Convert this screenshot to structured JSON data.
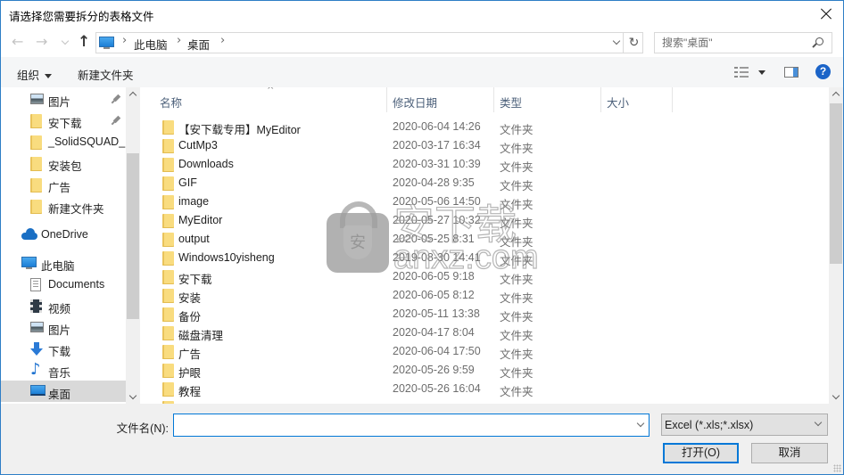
{
  "window": {
    "title": "请选择您需要拆分的表格文件"
  },
  "navigation": {
    "back_glyph": "←",
    "forward_glyph": "→",
    "up_glyph": "↑",
    "refresh_glyph": "↻"
  },
  "address": {
    "location_icon": "pc-icon",
    "separator": "›",
    "segments": [
      "此电脑",
      "桌面"
    ]
  },
  "search": {
    "placeholder": "搜索\"桌面\"",
    "value": ""
  },
  "toolbar": {
    "organize_label": "组织",
    "new_folder_label": "新建文件夹",
    "help_glyph": "?"
  },
  "sidebar": {
    "items": [
      {
        "label": "图片",
        "icon": "pictures-icon",
        "level": 2,
        "pinned": true,
        "selected": false
      },
      {
        "label": "安下载",
        "icon": "folder-icon",
        "level": 2,
        "pinned": true,
        "selected": false
      },
      {
        "label": "_SolidSQUAD_",
        "icon": "folder-icon",
        "level": 2,
        "pinned": false,
        "selected": false
      },
      {
        "label": "安装包",
        "icon": "folder-icon",
        "level": 2,
        "pinned": false,
        "selected": false
      },
      {
        "label": "广告",
        "icon": "folder-icon",
        "level": 2,
        "pinned": false,
        "selected": false
      },
      {
        "label": "新建文件夹",
        "icon": "folder-icon",
        "level": 2,
        "pinned": false,
        "selected": false
      },
      {
        "label": "OneDrive",
        "icon": "onedrive-icon",
        "level": 1,
        "pinned": false,
        "selected": false
      },
      {
        "label": "此电脑",
        "icon": "pc-icon",
        "level": 1,
        "pinned": false,
        "selected": false
      },
      {
        "label": "Documents",
        "icon": "documents-icon",
        "level": 2,
        "pinned": false,
        "selected": false
      },
      {
        "label": "视频",
        "icon": "videos-icon",
        "level": 2,
        "pinned": false,
        "selected": false
      },
      {
        "label": "图片",
        "icon": "pictures-icon",
        "level": 2,
        "pinned": false,
        "selected": false
      },
      {
        "label": "下载",
        "icon": "downloads-icon",
        "level": 2,
        "pinned": false,
        "selected": false
      },
      {
        "label": "音乐",
        "icon": "music-icon",
        "level": 2,
        "pinned": false,
        "selected": false
      },
      {
        "label": "桌面",
        "icon": "desktop-icon",
        "level": 2,
        "pinned": false,
        "selected": true
      }
    ]
  },
  "list": {
    "columns": {
      "name": "名称",
      "modified": "修改日期",
      "type": "类型",
      "size": "大小"
    },
    "sort_glyph": "^",
    "files": [
      {
        "name": "【安下载专用】MyEditor",
        "modified": "2020-06-04 14:26",
        "type": "文件夹"
      },
      {
        "name": "CutMp3",
        "modified": "2020-03-17 16:34",
        "type": "文件夹"
      },
      {
        "name": "Downloads",
        "modified": "2020-03-31 10:39",
        "type": "文件夹"
      },
      {
        "name": "GIF",
        "modified": "2020-04-28 9:35",
        "type": "文件夹"
      },
      {
        "name": "image",
        "modified": "2020-05-06 14:50",
        "type": "文件夹"
      },
      {
        "name": "MyEditor",
        "modified": "2020-05-27 10:32",
        "type": "文件夹"
      },
      {
        "name": "output",
        "modified": "2020-05-25 8:31",
        "type": "文件夹"
      },
      {
        "name": "Windows10yisheng",
        "modified": "2019-08-30 14:41",
        "type": "文件夹"
      },
      {
        "name": "安下载",
        "modified": "2020-06-05 9:18",
        "type": "文件夹"
      },
      {
        "name": "安装",
        "modified": "2020-06-05 8:12",
        "type": "文件夹"
      },
      {
        "name": "备份",
        "modified": "2020-05-11 13:38",
        "type": "文件夹"
      },
      {
        "name": "磁盘清理",
        "modified": "2020-04-17 8:04",
        "type": "文件夹"
      },
      {
        "name": "广告",
        "modified": "2020-06-04 17:50",
        "type": "文件夹"
      },
      {
        "name": "护眼",
        "modified": "2020-05-26 9:59",
        "type": "文件夹"
      },
      {
        "name": "教程",
        "modified": "2020-05-26 16:04",
        "type": "文件夹"
      },
      {
        "name": "",
        "modified": "",
        "type": ""
      }
    ]
  },
  "watermark": {
    "badge": "安",
    "text": "安下载",
    "domain": "anxz.com"
  },
  "footer": {
    "filename_label": "文件名(N):",
    "filename_value": "",
    "filter_value": "Excel (*.xls;*.xlsx)",
    "open_label": "打开(O)",
    "cancel_label": "取消"
  },
  "colors": {
    "window_border": "#2e7ec6",
    "focus_accent": "#0078d7",
    "help_icon": "#1b64c8",
    "selected_nav": "#d9d9d9",
    "folder": "#f9dc7f"
  }
}
